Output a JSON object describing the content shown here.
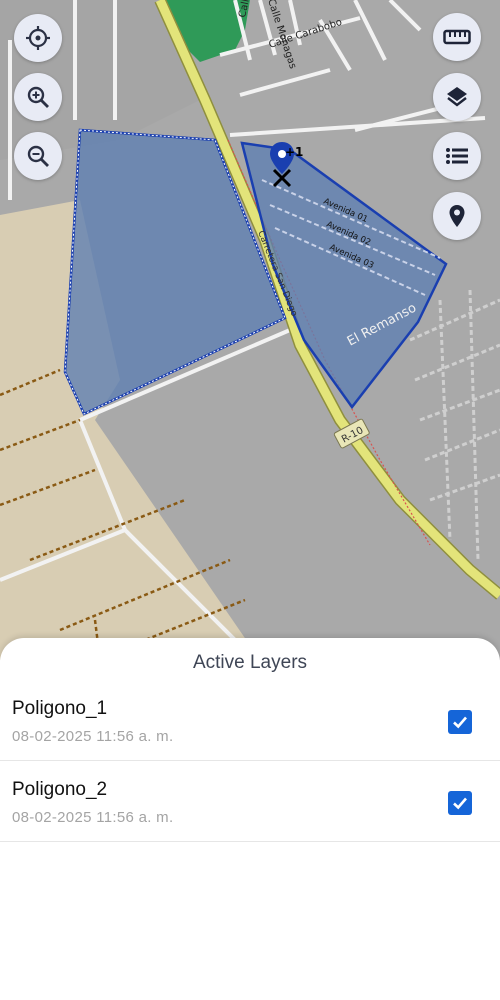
{
  "map": {
    "street_labels": {
      "calle_aragua": "Calle Aragua",
      "calle_monagas": "Calle Monagas",
      "calle_carabobo": "Calle Carabobo",
      "avenida_01": "Avenida 01",
      "avenida_02": "Avenida 02",
      "avenida_03": "Avenida 03",
      "carretera": "Carretera San Diego",
      "r10": "R-10"
    },
    "place_label": "El Remanso",
    "marker_badge": "+1",
    "colors": {
      "base": "#a7a7a7",
      "road_yellow": "#e3e47a",
      "polygon_fill": "#5d7fb2",
      "polygon_stroke": "#1a3fb0",
      "green_area": "#2e9a57",
      "sand_area": "#d7ccb3",
      "accent": "#1565d8"
    }
  },
  "controls": {
    "my_location": "my-location-icon",
    "zoom_in": "zoom-in-icon",
    "zoom_out": "zoom-out-icon",
    "measure": "ruler-icon",
    "layers": "layers-icon",
    "list": "list-icon",
    "poi": "location-pin-icon"
  },
  "sheet": {
    "title": "Active Layers",
    "layers": [
      {
        "name": "Poligono_1",
        "date": "08-02-2025 11:56 a. m.",
        "checked": true
      },
      {
        "name": "Poligono_2",
        "date": "08-02-2025 11:56 a. m.",
        "checked": true
      }
    ]
  }
}
